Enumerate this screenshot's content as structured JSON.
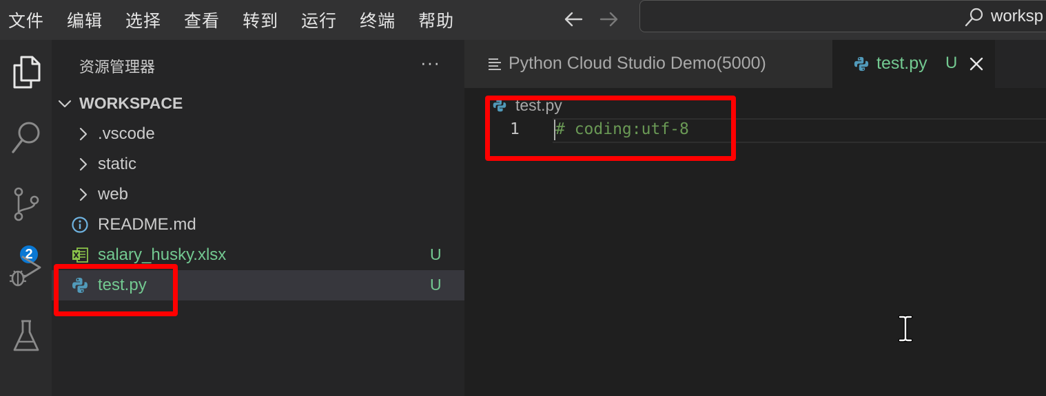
{
  "menubar": {
    "items": [
      "文件",
      "编辑",
      "选择",
      "查看",
      "转到",
      "运行",
      "终端",
      "帮助"
    ],
    "back_icon": "arrow-left-icon",
    "forward_icon": "arrow-right-icon",
    "command_center_text": "worksp"
  },
  "activitybar": {
    "items": [
      "explorer-icon",
      "search-icon",
      "source-control-icon",
      "run-debug-icon",
      "testing-icon"
    ],
    "source_control_badge": "2"
  },
  "sidebar": {
    "title": "资源管理器",
    "more": "···",
    "workspace_label": "WORKSPACE",
    "tree": [
      {
        "label": ".vscode",
        "type": "folder"
      },
      {
        "label": "static",
        "type": "folder"
      },
      {
        "label": "web",
        "type": "folder"
      },
      {
        "label": "README.md",
        "type": "file",
        "icon": "info-icon"
      },
      {
        "label": "salary_husky.xlsx",
        "type": "file",
        "icon": "excel-icon",
        "status": "U"
      },
      {
        "label": "test.py",
        "type": "file",
        "icon": "python-icon",
        "status": "U",
        "selected": true
      }
    ]
  },
  "tabs": [
    {
      "label": "Python Cloud Studio Demo(5000)",
      "icon": "preview-icon",
      "active": false
    },
    {
      "label": "test.py",
      "icon": "python-icon",
      "status": "U",
      "active": true
    }
  ],
  "editor": {
    "breadcrumb": "test.py",
    "lines": [
      {
        "number": "1",
        "text": "# coding:utf-8"
      }
    ]
  },
  "colors": {
    "accent_badge": "#0a78d4",
    "untracked_green": "#73c991",
    "comment_green": "#6a9955",
    "highlight_red": "#ff0000"
  }
}
